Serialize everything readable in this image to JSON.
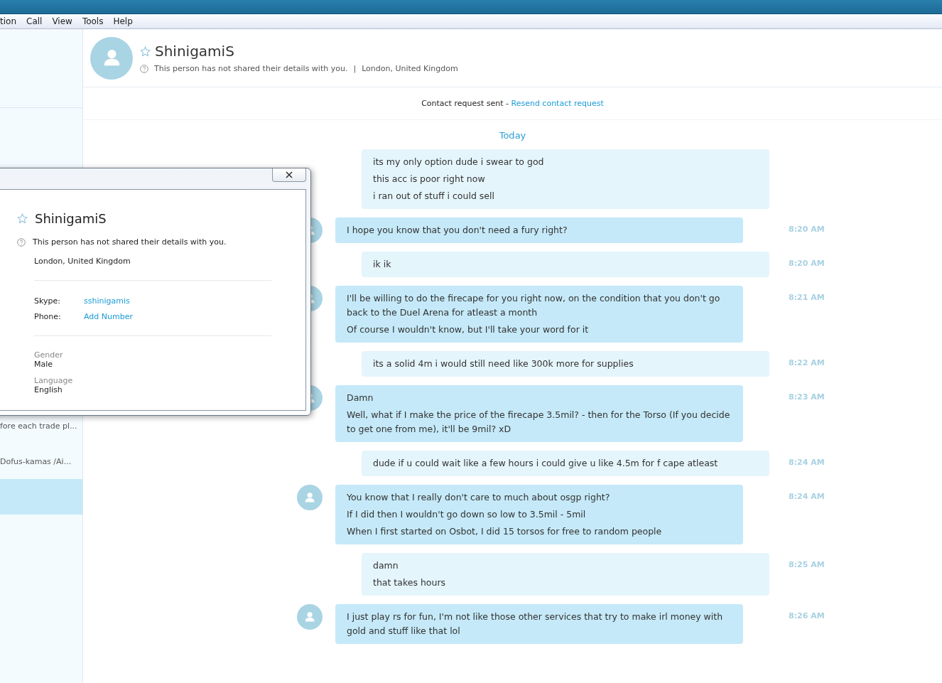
{
  "menu": [
    "tion",
    "Call",
    "View",
    "Tools",
    "Help"
  ],
  "sidebar": {
    "items": [
      {
        "text": "fore each trade pl...",
        "selected": false
      },
      {
        "text": "Dofus-kamas /Ai...",
        "selected": false
      },
      {
        "selected": true
      }
    ]
  },
  "header": {
    "name": "ShinigamiS",
    "favorite": false,
    "status": "This person has not shared their details with you.",
    "separator": "|",
    "location": "London, United Kingdom"
  },
  "request": {
    "text": "Contact request sent - ",
    "link": "Resend contact request"
  },
  "day": "Today",
  "messages": [
    {
      "kind": "outgoing",
      "lines": [
        "its my only option dude i swear to god",
        "this acc is poor right now",
        "i ran out of stuff i could sell"
      ]
    },
    {
      "kind": "incoming",
      "time": "8:20 AM",
      "lines": [
        "I hope you know that you don't need a fury right?"
      ]
    },
    {
      "kind": "outgoing",
      "time": "8:20 AM",
      "lines": [
        "ik ik"
      ]
    },
    {
      "kind": "incoming",
      "time": "8:21 AM",
      "lines": [
        "I'll be willing to do the firecape for you right now, on the condition that you don't go back to the Duel Arena for atleast a month",
        "Of course I wouldn't know, but I'll take your word for it"
      ]
    },
    {
      "kind": "outgoing",
      "time": "8:22 AM",
      "lines": [
        "its a solid 4m i would still need like 300k more for supplies"
      ]
    },
    {
      "kind": "incoming",
      "time": "8:23 AM",
      "lines": [
        "Damn",
        "Well, what if I make the price of the firecape 3.5mil? - then for the Torso (If you decide to get one from me), it'll be 9mil? xD"
      ]
    },
    {
      "kind": "outgoing",
      "time": "8:24 AM",
      "lines": [
        "dude if u could wait like a few hours i could give u like 4.5m for f cape atleast"
      ]
    },
    {
      "kind": "incoming",
      "time": "8:24 AM",
      "lines": [
        "You know that I really don't care to much about osgp right?",
        "If I did then I wouldn't go down so low to 3.5mil - 5mil",
        "When I first started on Osbot, I did 15 torsos for free to random people"
      ]
    },
    {
      "kind": "outgoing",
      "time": "8:25 AM",
      "lines": [
        "damn",
        "that takes hours"
      ]
    },
    {
      "kind": "incoming",
      "time": "8:26 AM",
      "lines": [
        "I just play rs for fun, I'm not like those other services that try to make irl money with gold and stuff like that lol"
      ]
    }
  ],
  "dialog": {
    "name": "ShinigamiS",
    "favorite": false,
    "status": "This person has not shared their details with you.",
    "location": "London, United Kingdom",
    "fields": [
      {
        "label": "Skype:",
        "value": "sshinigamis"
      },
      {
        "label": "Phone:",
        "value": "Add Number"
      }
    ],
    "details": [
      {
        "label": "Gender",
        "value": "Male"
      },
      {
        "label": "Language",
        "value": "English"
      }
    ]
  }
}
